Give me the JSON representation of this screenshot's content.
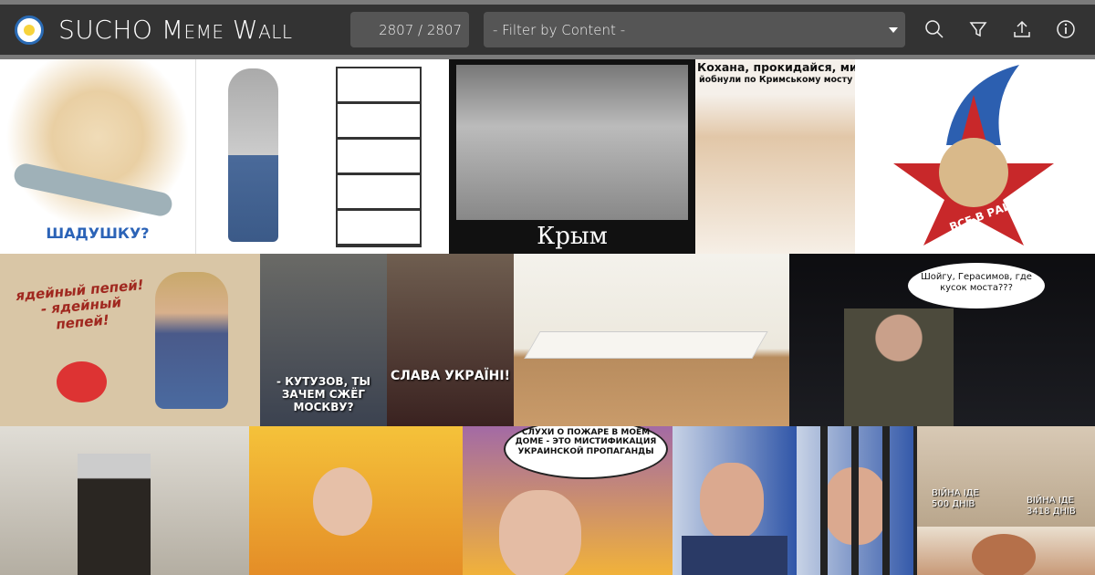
{
  "header": {
    "title": "SUCHO Meme Wall",
    "counter": "2807 / 2807",
    "filter_placeholder": "- Filter by Content -",
    "icons": [
      "search-icon",
      "filter-icon",
      "upload-icon",
      "info-icon"
    ]
  },
  "memes": [
    {
      "caption": "ШАДУШКУ?"
    },
    {
      "caption": ""
    },
    {
      "caption": ""
    },
    {
      "caption": "Крым"
    },
    {
      "caption": "Кохана, прокидайся, ми",
      "caption2": "йобнули по Кримському мосту"
    },
    {
      "caption": "ВСЕ В РАЙ"
    },
    {
      "caption": "ядейный пепей! - ядейный пепей!"
    },
    {
      "caption": "- КУТУЗОВ, ТЫ ЗАЧЕМ СЖЁГ МОСКВУ?"
    },
    {
      "caption": "СЛАВА УКРАЇНІ!"
    },
    {
      "caption": ""
    },
    {
      "caption": "Шойгу, Герасимов, где кусок моста???"
    },
    {
      "caption": ""
    },
    {
      "caption": ""
    },
    {
      "caption": "СЛУХИ О ПОЖАРЕ В МОЁМ ДОМЕ - ЭТО МИСТИФИКАЦИЯ УКРАИНСКОЙ ПРОПАГАНДЫ"
    },
    {
      "caption": ""
    },
    {
      "caption": ""
    },
    {
      "caption": "ВІЙНА ІДЕ 500 ДНІВ",
      "caption2": "ВІЙНА ІДЕ 3418 ДНІВ"
    },
    {
      "caption": ""
    }
  ]
}
